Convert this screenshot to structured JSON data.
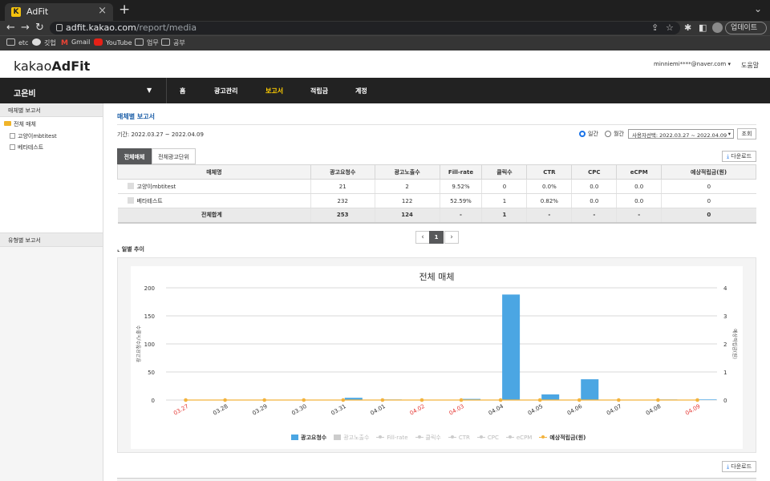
{
  "browser": {
    "tab_title": "AdFit",
    "tab_favicon": "K",
    "url_host": "adfit.kakao.com",
    "url_path": "/report/media",
    "update_label": "업데이트",
    "bookmarks": [
      "etc",
      "깃헙",
      "Gmail",
      "YouTube",
      "업무",
      "공부"
    ]
  },
  "header": {
    "logo_light": "kakao",
    "logo_bold": "AdFit",
    "user": "minniemi****@naver.com",
    "help": "도움말"
  },
  "gnb": {
    "account": "고은비",
    "items": [
      "홈",
      "광고관리",
      "보고서",
      "적립금",
      "계정"
    ],
    "active": "보고서"
  },
  "sidebar": {
    "section1": "매체별 보고서",
    "tree_root": "전체 매체",
    "tree_items": [
      "고양이mbtitest",
      "베타테스트"
    ],
    "section2": "유형별 보고서"
  },
  "report": {
    "title": "매체별 보고서",
    "period": "기간: 2022.03.27 ~ 2022.04.09",
    "radio_daily": "일간",
    "radio_monthly": "월간",
    "range_select": "사용자선택: 2022.03.27 ~ 2022.04.09",
    "query_button": "조회",
    "tabs": [
      "전체매체",
      "전체광고단위"
    ],
    "download": "다운로드",
    "columns": [
      "매체명",
      "광고요청수",
      "광고노출수",
      "Fill-rate",
      "클릭수",
      "CTR",
      "CPC",
      "eCPM",
      "예상적립금(원)"
    ],
    "rows": [
      [
        "고양이mbtitest",
        "21",
        "2",
        "9.52%",
        "0",
        "0.0%",
        "0.0",
        "0.0",
        "0"
      ],
      [
        "베타테스트",
        "232",
        "122",
        "52.59%",
        "1",
        "0.82%",
        "0.0",
        "0.0",
        "0"
      ]
    ],
    "total_row": [
      "전체합계",
      "253",
      "124",
      "-",
      "1",
      "-",
      "-",
      "-",
      "0"
    ],
    "pager": {
      "prev": "‹",
      "current": "1",
      "next": "›"
    },
    "trend_label": "일별 추이"
  },
  "chart_data": {
    "type": "bar",
    "title": "전체 매체",
    "categories": [
      "03.27",
      "03.28",
      "03.29",
      "03.30",
      "03.31",
      "04.01",
      "04.02",
      "04.03",
      "04.04",
      "04.05",
      "04.06",
      "04.07",
      "04.08",
      "04.09"
    ],
    "weekend_color": "#e53935",
    "weekend_categories": [
      "03.27",
      "04.02",
      "04.03",
      "04.09"
    ],
    "ylabel_left": "광고요청수/노출수",
    "ylabel_right": "예상적립금(원)",
    "ylim_left": [
      0,
      200
    ],
    "yticks_left": [
      "0",
      "50",
      "100",
      "150",
      "200"
    ],
    "ylim_right": [
      0,
      4
    ],
    "yticks_right": [
      "0",
      "1",
      "2",
      "3",
      "4"
    ],
    "series": [
      {
        "name": "광고요청수",
        "type": "bar",
        "color": "#4ba6e3",
        "values": [
          0,
          0,
          0,
          0,
          4,
          1,
          0,
          2,
          188,
          10,
          37,
          0,
          1,
          1
        ]
      },
      {
        "name": "예상적립금(원)",
        "type": "line",
        "color": "#f3b33d",
        "axis": "right",
        "values": [
          0,
          0,
          0,
          0,
          0,
          0,
          0,
          0,
          0,
          0,
          0,
          0,
          0,
          0
        ]
      }
    ],
    "legend": [
      "광고요청수",
      "광고노출수",
      "Fill-rate",
      "클릭수",
      "CTR",
      "CPC",
      "eCPM",
      "예상적립금(원)"
    ],
    "grid": true
  }
}
